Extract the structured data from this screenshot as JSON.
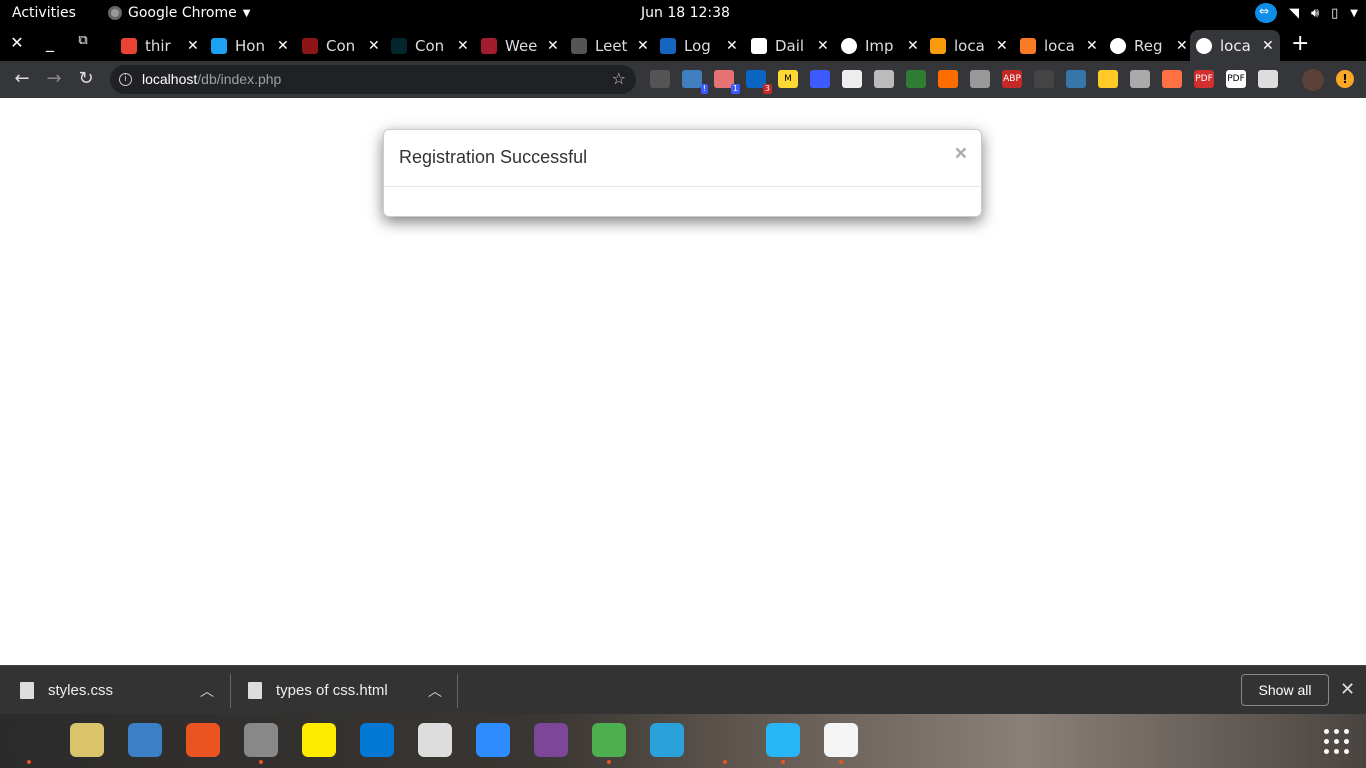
{
  "topbar": {
    "activities": "Activities",
    "app_name": "Google Chrome",
    "app_menu_icon": "chevron-down-icon",
    "clock": "Jun 18  12:38"
  },
  "tabs": [
    {
      "title": "thir",
      "favicon": "gmail-icon",
      "color": "#ea4335"
    },
    {
      "title": "Hon",
      "favicon": "twitter-icon",
      "color": "#1da1f2"
    },
    {
      "title": "Con",
      "favicon": "stanford-icon",
      "color": "#8c1515"
    },
    {
      "title": "Con",
      "favicon": "edx-icon",
      "color": "#02262b"
    },
    {
      "title": "Wee",
      "favicon": "harvard-icon",
      "color": "#a51c30"
    },
    {
      "title": "Leet",
      "favicon": "github-icon",
      "color": "#555555"
    },
    {
      "title": "Log",
      "favicon": "mail-icon",
      "color": "#1565c0"
    },
    {
      "title": "Dail",
      "favicon": "trello-icon",
      "color": "#ffffff"
    },
    {
      "title": "Imp",
      "favicon": "globe-icon",
      "color": "#ffffff"
    },
    {
      "title": "loca",
      "favicon": "phpmyadmin-icon",
      "color": "#f89c0e"
    },
    {
      "title": "loca",
      "favicon": "xampp-icon",
      "color": "#fb7a24"
    },
    {
      "title": "Reg",
      "favicon": "globe-icon",
      "color": "#ffffff"
    },
    {
      "title": "loca",
      "favicon": "globe-icon",
      "color": "#ffffff",
      "active": true
    }
  ],
  "toolbar": {
    "url_host": "localhost",
    "url_path": "/db/index.php"
  },
  "extensions": [
    {
      "name": "quote-ext-icon",
      "color": "#555"
    },
    {
      "name": "myjson-ext-icon",
      "color": "#3f7fbf",
      "badge": "!"
    },
    {
      "name": "extension-ext-icon",
      "color": "#e57373",
      "badge": "1"
    },
    {
      "name": "linkedin-ext-icon",
      "color": "#0a66c2",
      "badge": "3"
    },
    {
      "name": "m-ext-icon",
      "color": "#fdd835",
      "label": "M"
    },
    {
      "name": "wave-ext-icon",
      "color": "#3d5afe"
    },
    {
      "name": "reader-ext-icon",
      "color": "#eee"
    },
    {
      "name": "bulb-ext-icon",
      "color": "#bbb"
    },
    {
      "name": "screenshot-ext-icon",
      "color": "#2e7d32"
    },
    {
      "name": "b-ext-icon",
      "color": "#ff6d00"
    },
    {
      "name": "hand-ext-icon",
      "color": "#999"
    },
    {
      "name": "adblock-ext-icon",
      "color": "#c62828",
      "label": "ABP"
    },
    {
      "name": "recycle-ext-icon",
      "color": "#444"
    },
    {
      "name": "python-ext-icon",
      "color": "#3776ab"
    },
    {
      "name": "thumb-ext-icon",
      "color": "#ffca28"
    },
    {
      "name": "feather-ext-icon",
      "color": "#aaa"
    },
    {
      "name": "circle-ext-icon",
      "color": "#ff7043"
    },
    {
      "name": "pdf-ext-icon",
      "color": "#d32f2f",
      "label": "PDF"
    },
    {
      "name": "pdf2-ext-icon",
      "color": "#fff",
      "label": "PDF"
    },
    {
      "name": "draw-ext-icon",
      "color": "#ddd"
    }
  ],
  "modal": {
    "title": "Registration Successful",
    "close": "×"
  },
  "downloads": {
    "items": [
      {
        "name": "styles.css"
      },
      {
        "name": "types of css.html"
      }
    ],
    "show_all": "Show all",
    "close": "✕"
  },
  "dock": [
    {
      "name": "terminal-app-icon",
      "color": "#2c2c2c",
      "running": true
    },
    {
      "name": "rhythmbox-app-icon",
      "color": "#d9c46b"
    },
    {
      "name": "writer-app-icon",
      "color": "#3b7fc4"
    },
    {
      "name": "software-app-icon",
      "color": "#e95420"
    },
    {
      "name": "files-app-icon",
      "color": "#888",
      "running": true
    },
    {
      "name": "notes-app-icon",
      "color": "#ffeb00"
    },
    {
      "name": "vscode-app-icon",
      "color": "#0078d4"
    },
    {
      "name": "document-viewer-app-icon",
      "color": "#ddd"
    },
    {
      "name": "zoom-app-icon",
      "color": "#2d8cff"
    },
    {
      "name": "tor-app-icon",
      "color": "#7d4698"
    },
    {
      "name": "chrome-app-icon",
      "color": "#4caf50",
      "running": true
    },
    {
      "name": "telegram-app-icon",
      "color": "#2aa1da"
    },
    {
      "name": "unknown-app-icon",
      "color": "transparent",
      "running": true
    },
    {
      "name": "kstars-app-icon",
      "color": "#29b6f6",
      "running": true
    },
    {
      "name": "text-editor-app-icon",
      "color": "#f5f5f5",
      "running": true
    }
  ]
}
